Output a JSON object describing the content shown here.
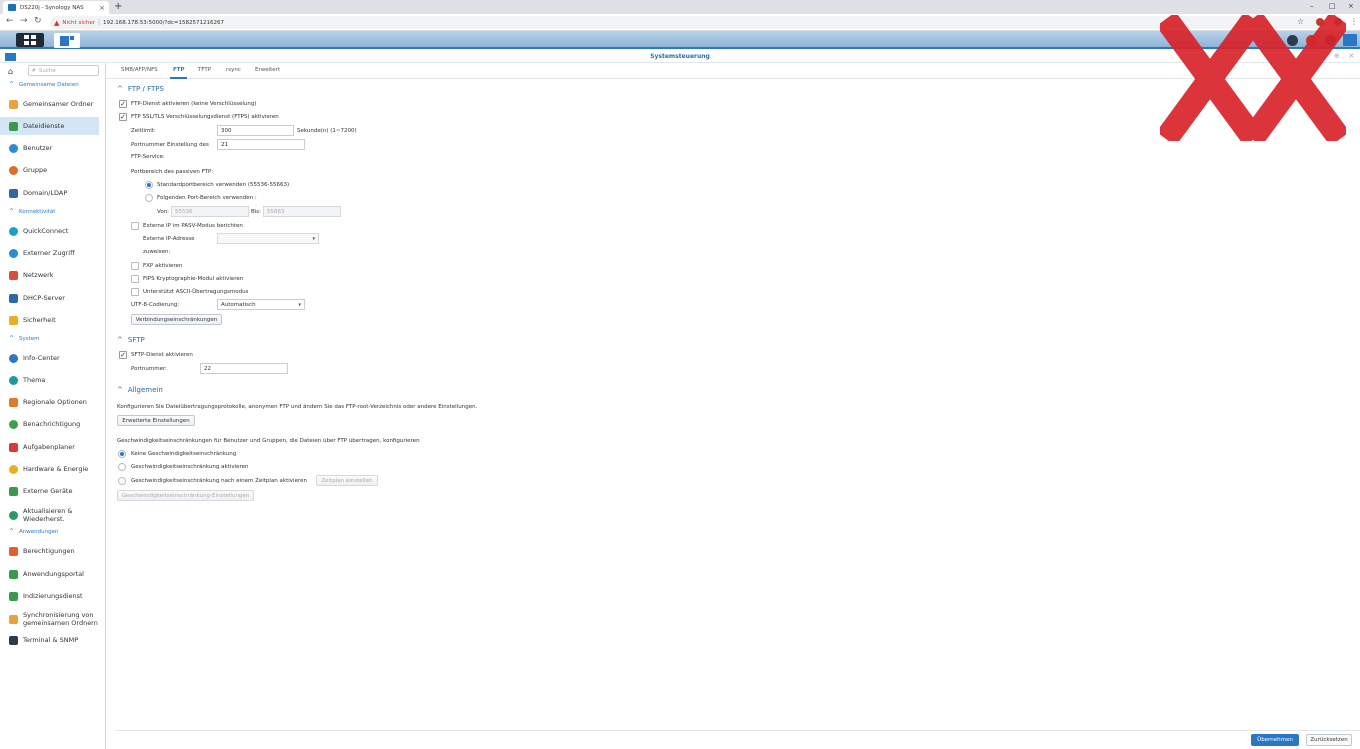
{
  "browser": {
    "tab_title": "DS220j - Synology NAS",
    "close_glyph": "×",
    "new_tab_glyph": "+",
    "back_glyph": "←",
    "forward_glyph": "→",
    "reload_glyph": "↻",
    "not_secure": "Nicht sicher",
    "separator": "|",
    "url": "192.168.178.53:5000/?dc=1582571216267",
    "win_min": "–",
    "win_max": "□",
    "win_close": "×",
    "star_glyph": "☆"
  },
  "window": {
    "title": "Systemsteuerung",
    "min": "–",
    "max": "⊕",
    "close": "×"
  },
  "sidebar": {
    "search_placeholder": "Suche",
    "sections": {
      "shared": "Gemeinsame Dateien",
      "connectivity": "Konnektivität",
      "system": "System",
      "apps": "Anwendungen"
    },
    "items": [
      {
        "label": "Gemeinsamer Ordner",
        "color": "#e8a33a"
      },
      {
        "label": "Dateidienste",
        "color": "#3a9a4a"
      },
      {
        "label": "Benutzer",
        "color": "#2a8ad4"
      },
      {
        "label": "Gruppe",
        "color": "#e06a2a"
      },
      {
        "label": "Domain/LDAP",
        "color": "#2a6aa8"
      },
      {
        "label": "QuickConnect",
        "color": "#1aa0c8"
      },
      {
        "label": "Externer Zugriff",
        "color": "#2a8ad4"
      },
      {
        "label": "Netzwerk",
        "color": "#d8503a"
      },
      {
        "label": "DHCP-Server",
        "color": "#2a6aa8"
      },
      {
        "label": "Sicherheit",
        "color": "#e8b020"
      },
      {
        "label": "Info-Center",
        "color": "#2a78c5"
      },
      {
        "label": "Thema",
        "color": "#1a9a9a"
      },
      {
        "label": "Regionale Optionen",
        "color": "#e07a2a"
      },
      {
        "label": "Benachrichtigung",
        "color": "#3aa04a"
      },
      {
        "label": "Aufgabenplaner",
        "color": "#d83a3a"
      },
      {
        "label": "Hardware & Energie",
        "color": "#e8b020"
      },
      {
        "label": "Externe Geräte",
        "color": "#3a9a4a"
      },
      {
        "label": "Aktualisieren & Wiederherst.",
        "color": "#2a9a6a"
      },
      {
        "label": "Berechtigungen",
        "color": "#e0602a"
      },
      {
        "label": "Anwendungsportal",
        "color": "#3a9a4a"
      },
      {
        "label": "Indizierungsdienst",
        "color": "#3a9a4a"
      },
      {
        "label": "Synchronisierung von gemeinsamen Ordnern",
        "color": "#e8a33a"
      },
      {
        "label": "Terminal & SNMP",
        "color": "#2d3b4a"
      }
    ]
  },
  "tabs": [
    "SMB/AFP/NFS",
    "FTP",
    "TFTP",
    "rsync",
    "Erweitert"
  ],
  "ftp": {
    "heading": "FTP / FTPS",
    "enable_ftp": "FTP-Dienst aktivieren (keine Verschlüsselung)",
    "enable_ftps": "FTP SSL/TLS Verschlüsselungsdienst (FTPS) aktivieren",
    "timeout_label": "Zeitlimit:",
    "timeout_value": "300",
    "timeout_unit": "Sekunde(n) (1~7200)",
    "port_label_1": "Portnummer Einstellung des",
    "port_label_2": "FTP-Service:",
    "port_value": "21",
    "passive_label": "Portbereich des passiven FTP:",
    "passive_default": "Standardportbereich verwenden (55536-55663)",
    "passive_custom": "Folgenden Port-Bereich verwenden :",
    "from_label": "Von:",
    "from_value": "55536",
    "to_label": "Bis:",
    "to_value": "55663",
    "report_ext_ip": "Externe IP im PASV-Modus berichten",
    "ext_ip_label_1": "Externe IP-Adresse",
    "ext_ip_label_2": "zuweisen:",
    "fxp": "FXP aktivieren",
    "fips": "FIPS Kryptographie-Modul aktivieren",
    "ascii": "Unterstützt ASCII-Übertragungsmodus",
    "utf8_label": "UTF-8-Codierung:",
    "utf8_value": "Automatisch",
    "conn_limit_button": "Verbindungseinschränkungen",
    "check_glyph": "✓",
    "caret_glyph": "▾",
    "chevron_glyph": "^"
  },
  "sftp": {
    "heading": "SFTP",
    "enable": "SFTP-Dienst aktivieren",
    "port_label": "Portnummer:",
    "port_value": "22"
  },
  "general": {
    "heading": "Allgemein",
    "description": "Konfigurieren Sie Dateiübertragungsprotokolle, anonymen FTP und ändern Sie das FTP-root-Verzeichnis oder andere Einstellungen.",
    "advanced_button": "Erweiterte Einstellungen",
    "speed_desc": "Geschwindigkeitseinschränkungen für Benutzer und Gruppen, die Dateien über FTP übertragen, konfigurieren",
    "speed_none": "Keine Geschwindigkeitseinschränkung",
    "speed_enable": "Geschwindigkeitseinschränkung aktivieren",
    "speed_schedule": "Geschwindigkeitseinschränkung nach einem Zeitplan aktivieren",
    "schedule_button": "Zeitplan einstellen",
    "speed_settings_button": "Geschwindigkeitseinschränkung-Einstellungen"
  },
  "footer": {
    "apply": "Übernehmen",
    "reset": "Zurücksetzen"
  },
  "colors": {
    "accent": "#2a78c5",
    "overlay_x": "#d8232a"
  }
}
